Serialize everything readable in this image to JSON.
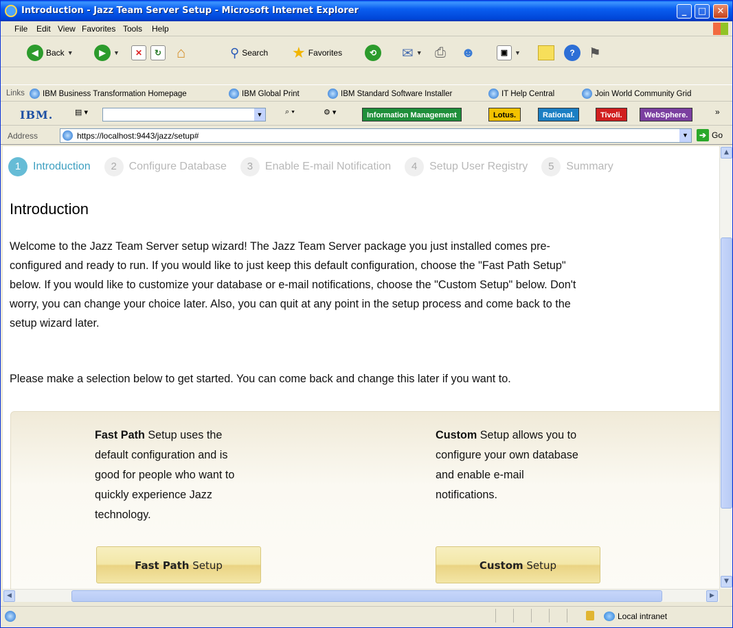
{
  "window": {
    "title": "Introduction - Jazz Team Server Setup - Microsoft Internet Explorer",
    "minimize": "_",
    "maximize": "□",
    "close": "✕"
  },
  "menu": [
    "File",
    "Edit",
    "View",
    "Favorites",
    "Tools",
    "Help"
  ],
  "toolbar": {
    "back_label": "Back",
    "search_label": "Search",
    "favorites_label": "Favorites"
  },
  "links": {
    "label": "Links",
    "items": [
      "IBM Business Transformation Homepage",
      "IBM Global Print",
      "IBM Standard Software Installer",
      "IT Help Central",
      "Join World Community Grid"
    ]
  },
  "ibm_toolbar": {
    "logo": "IBM.",
    "combo_value": "",
    "pills": [
      {
        "label": "Information Management",
        "color": "#1f8f3a"
      },
      {
        "label": "Lotus.",
        "color": "#f2c200"
      },
      {
        "label": "Rational.",
        "color": "#1b7fc4"
      },
      {
        "label": "Tivoli.",
        "color": "#d11f1f"
      },
      {
        "label": "WebSphere.",
        "color": "#7b3fa0"
      }
    ]
  },
  "address": {
    "label": "Address",
    "url": "https://localhost:9443/jazz/setup#",
    "go_label": "Go"
  },
  "wizard": {
    "steps": [
      {
        "num": "1",
        "label": "Introduction"
      },
      {
        "num": "2",
        "label": "Configure Database"
      },
      {
        "num": "3",
        "label": "Enable E-mail Notification"
      },
      {
        "num": "4",
        "label": "Setup User Registry"
      },
      {
        "num": "5",
        "label": "Summary"
      }
    ],
    "active_step": 1
  },
  "page": {
    "heading": "Introduction",
    "welcome_lines": [
      "Welcome to the Jazz Team Server setup wizard! The Jazz Team Server package you just installed comes pre-",
      "configured and ready to run. If you would like to just keep this default configuration, choose the \"Fast Path Setup\"",
      "below. If you would like to customize your database or e-mail notifications, choose the \"Custom Setup\" below. Don't",
      "worry, you can change your choice later. Also, you can quit at any point in the setup process and come back to the",
      "setup wizard later."
    ],
    "selection_text": "Please make a selection below to get started. You can come back and change this later if you want to."
  },
  "options": {
    "fast": {
      "bold": "Fast Path",
      "desc_lines": [
        " Setup uses the",
        "default configuration and is",
        "good for people who want to",
        "quickly experience Jazz",
        "technology."
      ],
      "button_bold": "Fast Path",
      "button_rest": " Setup"
    },
    "custom": {
      "bold": "Custom",
      "desc_lines": [
        " Setup allows you to",
        "configure your own database",
        "and enable e-mail",
        "notifications."
      ],
      "button_bold": "Custom",
      "button_rest": " Setup"
    }
  },
  "status": {
    "zone": "Local intranet"
  }
}
